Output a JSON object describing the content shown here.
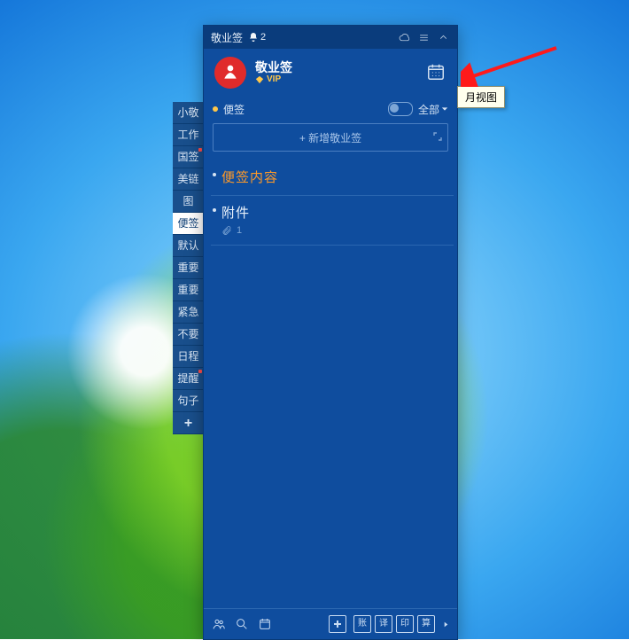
{
  "titlebar": {
    "title": "敬业签",
    "notif_count": "2"
  },
  "user": {
    "name": "敬业签",
    "vip": "VIP"
  },
  "tooltip": "月视图",
  "section": {
    "title": "便签",
    "filter": "全部"
  },
  "add_placeholder": "+ 新增敬业签",
  "entries": [
    {
      "text": "便签内容",
      "accent": true
    },
    {
      "text": "附件",
      "accent": false,
      "attachment_count": "1"
    }
  ],
  "side_tabs": [
    {
      "label": "小敬"
    },
    {
      "label": "工作"
    },
    {
      "label": "国签",
      "notch": true
    },
    {
      "label": "美链"
    },
    {
      "label": "图"
    },
    {
      "label": "便签",
      "active": true
    },
    {
      "label": "默认"
    },
    {
      "label": "重要"
    },
    {
      "label": "重要"
    },
    {
      "label": "紧急"
    },
    {
      "label": "不要"
    },
    {
      "label": "日程"
    },
    {
      "label": "提醒",
      "notch": true
    },
    {
      "label": "句子"
    },
    {
      "label": "+",
      "add": true
    }
  ],
  "bottom": {
    "btns": [
      "账",
      "译",
      "印",
      "算"
    ]
  }
}
